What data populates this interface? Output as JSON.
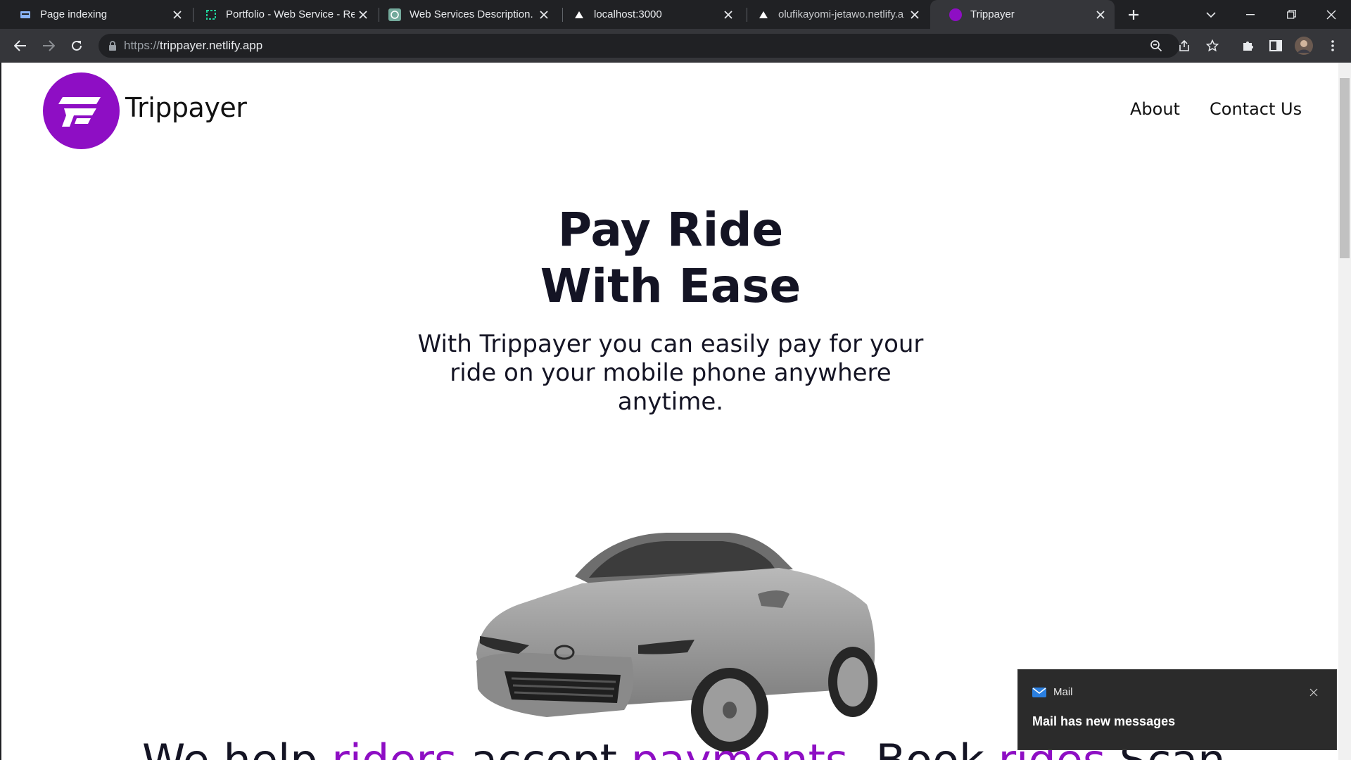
{
  "browser": {
    "tabs": [
      {
        "title": "Page indexing",
        "icon": "search-console-icon",
        "active": false
      },
      {
        "title": "Portfolio - Web Service - Re",
        "icon": "replit-icon",
        "active": false
      },
      {
        "title": "Web Services Description.",
        "icon": "chatgpt-icon",
        "active": false
      },
      {
        "title": "localhost:3000",
        "icon": "triangle-icon",
        "active": false
      },
      {
        "title": "olufikayomi-jetawo.netlify.a",
        "icon": "triangle-icon",
        "active": false
      },
      {
        "title": "Trippayer",
        "icon": "trippayer-favicon",
        "active": true
      }
    ],
    "address": {
      "scheme": "https://",
      "host": "trippayer.netlify.app"
    }
  },
  "site": {
    "brand": "Trippayer",
    "nav": {
      "about": "About",
      "contact": "Contact Us"
    },
    "hero": {
      "title_line1": "Pay Ride",
      "title_line2": "With Ease",
      "subtitle": "With Trippayer you can easily pay for your ride on your mobile phone anywhere anytime."
    },
    "tagline": {
      "p1": "We help ",
      "p2": "riders",
      "p3": " accept ",
      "p4": "payments",
      "p5": ", Book ",
      "p6": "rides",
      "p7": " Scan"
    },
    "accent_color": "#8e0ec4"
  },
  "notification": {
    "app": "Mail",
    "message": "Mail has new messages"
  }
}
